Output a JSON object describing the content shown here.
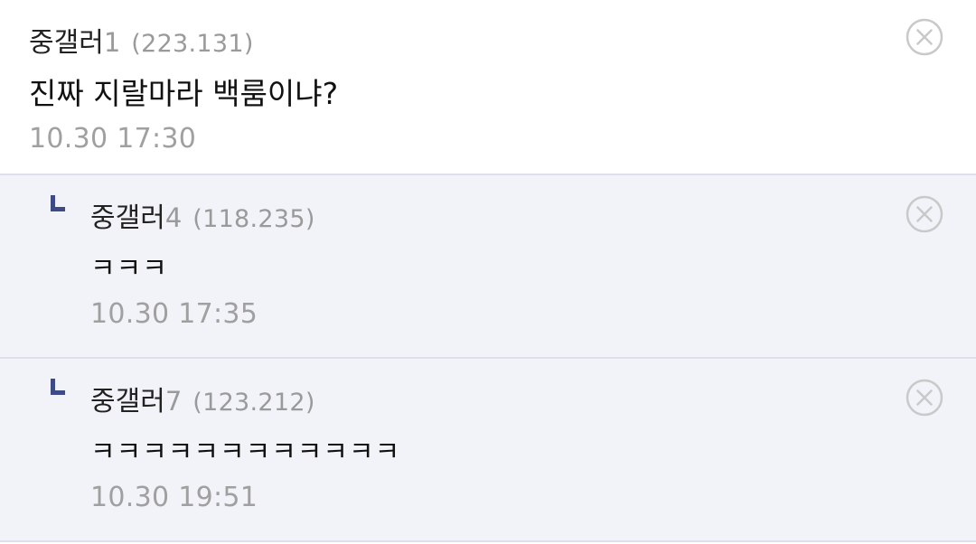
{
  "comments": [
    {
      "nick": "중갤러",
      "nick_num": "1",
      "ip": "(223.131)",
      "body": "진짜 지랄마라 백룸이냐?",
      "time": "10.30 17:30"
    },
    {
      "nick": "중갤러",
      "nick_num": "4",
      "ip": "(118.235)",
      "body": "ㅋㅋㅋ",
      "time": "10.30 17:35"
    },
    {
      "nick": "중갤러",
      "nick_num": "7",
      "ip": "(123.212)",
      "body": "ㅋㅋㅋㅋㅋㅋㅋㅋㅋㅋㅋㅋ",
      "time": "10.30 19:51"
    }
  ],
  "icons": {
    "delete": "circle-x-icon",
    "reply_marker": "reply-arrow-icon"
  },
  "colors": {
    "reply_marker": "#3c4a86",
    "reply_background": "#f2f3f8",
    "meta_text": "#9a9a9a",
    "divider": "#dde0ea"
  }
}
